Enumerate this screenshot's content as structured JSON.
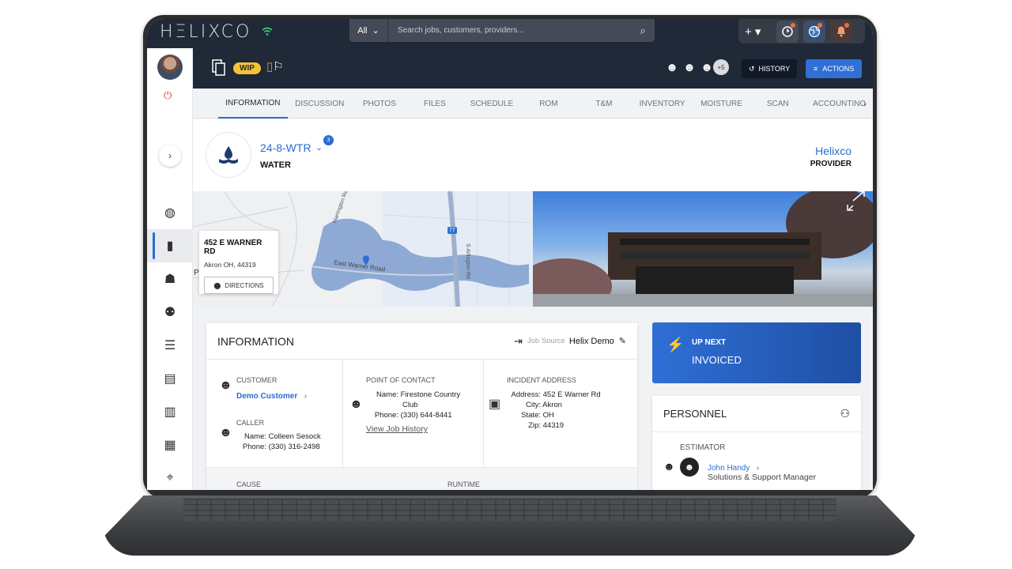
{
  "topbar": {
    "logo": "HΞLIXCO",
    "search_scope": "All",
    "search_placeholder": "Search jobs, customers, providers...",
    "plus_label": "+ ▾"
  },
  "jobhead": {
    "status_badge": "WIP",
    "people_more": "+5",
    "history_label": "HISTORY",
    "actions_label": "ACTIONS"
  },
  "tabs": [
    "INFORMATION",
    "DISCUSSION",
    "PHOTOS",
    "FILES",
    "SCHEDULE",
    "ROM",
    "T&M",
    "INVENTORY",
    "MOISTURE",
    "SCAN",
    "ACCOUNTINC"
  ],
  "job": {
    "number": "24-8-WTR",
    "badge": "3",
    "type": "WATER",
    "provider_name": "Helixco",
    "provider_label": "PROVIDER"
  },
  "map": {
    "street": "452 E WARNER RD",
    "city": "Akron OH, 44319",
    "directions": "DIRECTIONS",
    "road1": "Harrington Rd",
    "road2": "East Warner Road",
    "road3": "S Arlington Rd",
    "shield": "77",
    "edge_p": "P"
  },
  "info": {
    "title": "INFORMATION",
    "job_source_label": "Job Source",
    "job_source_value": "Helix Demo",
    "customer_label": "CUSTOMER",
    "customer_name": "Demo Customer",
    "caller_label": "CALLER",
    "caller_name_key": "Name:",
    "caller_name": "Colleen Sesock",
    "caller_phone_key": "Phone:",
    "caller_phone": "(330) 316-2498",
    "poc_label": "POINT OF CONTACT",
    "poc_name_key": "Name:",
    "poc_name_1": "Firestone Country",
    "poc_name_2": "Club",
    "poc_phone_key": "Phone:",
    "poc_phone": "(330) 644-8441",
    "view_history": "View Job History",
    "incident_label": "INCIDENT ADDRESS",
    "addr_key": "Address:",
    "addr_val": "452 E Warner Rd",
    "city_key": "City:",
    "city_val": "Akron",
    "state_key": "State:",
    "state_val": "OH",
    "zip_key": "Zip:",
    "zip_val": "44319",
    "cause_label": "CAUSE",
    "runtime_label": "RUNTIME"
  },
  "upnext": {
    "label": "UP NEXT",
    "value": "INVOICED"
  },
  "personnel": {
    "title": "PERSONNEL",
    "role": "ESTIMATOR",
    "name": "John Handy",
    "position": "Solutions & Support Manager"
  },
  "colors": {
    "accent": "#2b6cd1",
    "wip": "#f6c338",
    "header": "#1f2937",
    "alert": "#f26b3a"
  }
}
